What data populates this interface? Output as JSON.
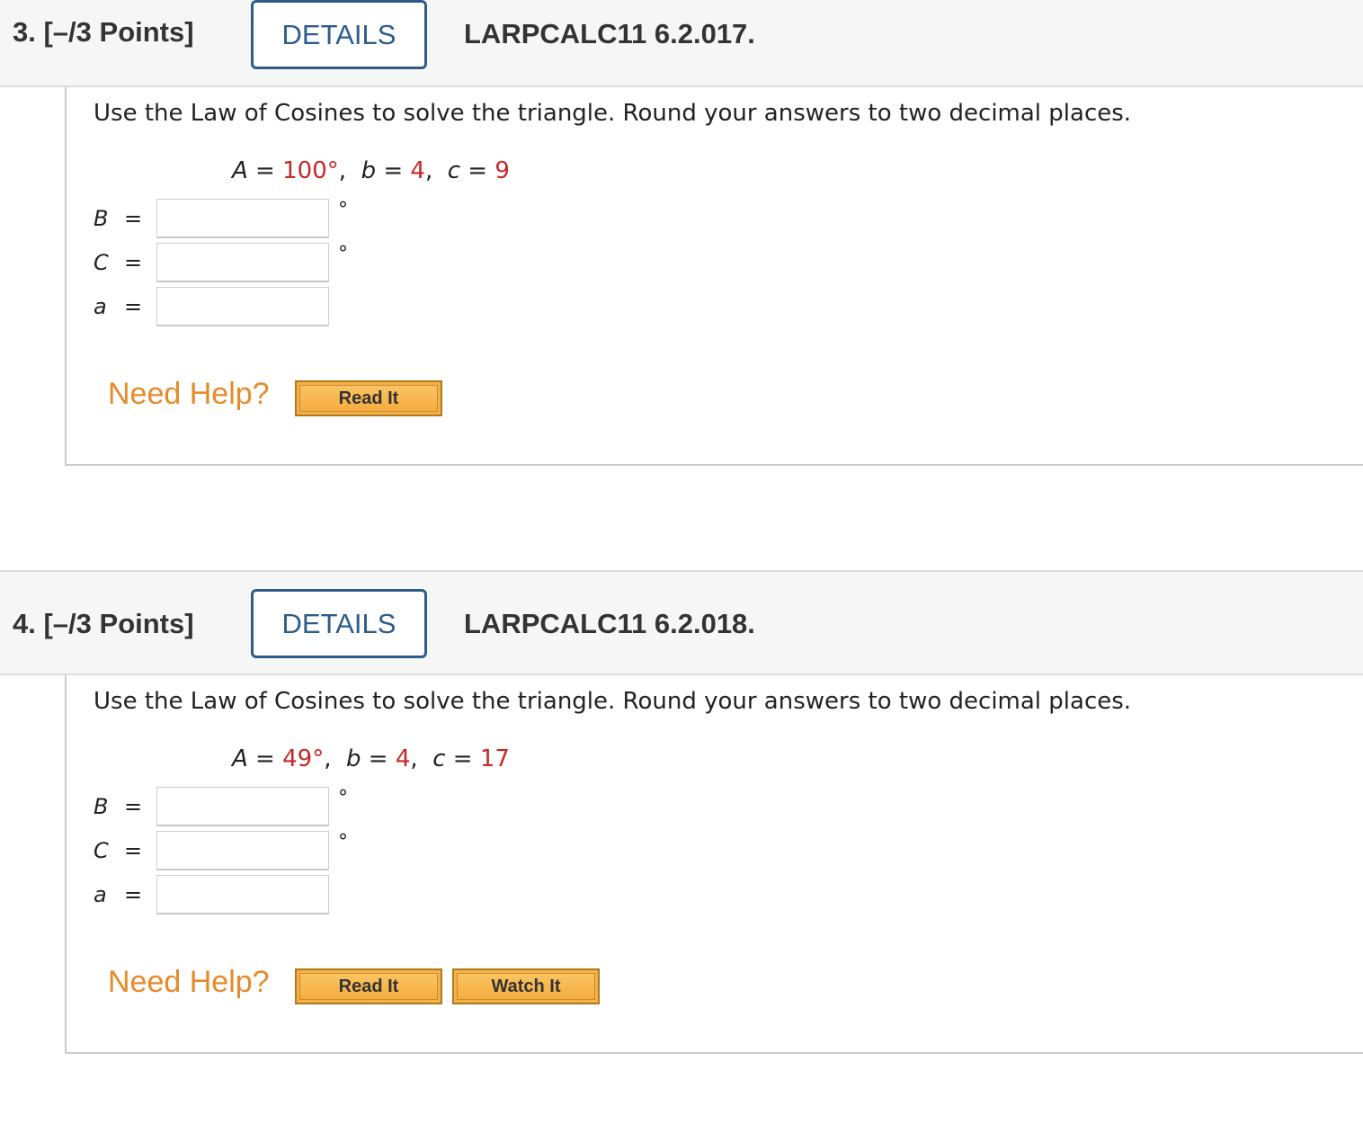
{
  "questions": [
    {
      "number": "3.",
      "points": "[–/3 Points]",
      "details_label": "DETAILS",
      "ref": "LARPCALC11 6.2.017.",
      "prompt": "Use the Law of Cosines to solve the triangle. Round your answers to two decimal places.",
      "given": {
        "A_label": "A",
        "A_value": "100°",
        "b_label": "b",
        "b_value": "4",
        "c_label": "c",
        "c_value": "9"
      },
      "answers": [
        {
          "label": "B",
          "value": "",
          "unit": "°"
        },
        {
          "label": "C",
          "value": "",
          "unit": "°"
        },
        {
          "label": "a",
          "value": "",
          "unit": ""
        }
      ],
      "need_help": "Need Help?",
      "help_buttons": [
        "Read It"
      ]
    },
    {
      "number": "4.",
      "points": "[–/3 Points]",
      "details_label": "DETAILS",
      "ref": "LARPCALC11 6.2.018.",
      "prompt": "Use the Law of Cosines to solve the triangle. Round your answers to two decimal places.",
      "given": {
        "A_label": "A",
        "A_value": "49°",
        "b_label": "b",
        "b_value": "4",
        "c_label": "c",
        "c_value": "17"
      },
      "answers": [
        {
          "label": "B",
          "value": "",
          "unit": "°"
        },
        {
          "label": "C",
          "value": "",
          "unit": "°"
        },
        {
          "label": "a",
          "value": "",
          "unit": ""
        }
      ],
      "need_help": "Need Help?",
      "help_buttons": [
        "Read It",
        "Watch It"
      ]
    }
  ],
  "colors": {
    "details_border": "#2d5c8a",
    "given_value": "#c62828",
    "need_help": "#e78a2a",
    "help_button": "#f4a93a"
  }
}
